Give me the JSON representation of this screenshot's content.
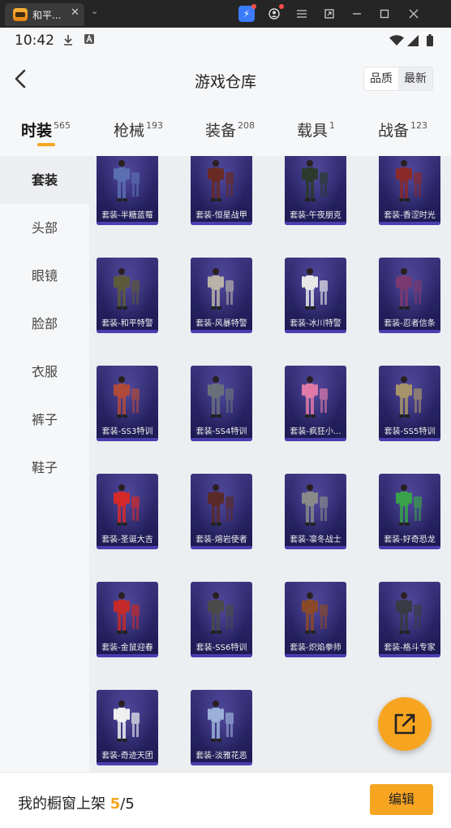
{
  "window": {
    "tab_title": "和平...",
    "close_glyph": "✕",
    "menu_glyph": "⌄",
    "toolbar_icons": [
      "lightning-icon",
      "user-icon",
      "hamburger-icon",
      "screenshot-icon",
      "minimize-icon",
      "maximize-icon",
      "close-icon"
    ]
  },
  "status_bar": {
    "time": "10:42"
  },
  "header": {
    "title": "游戏仓库",
    "sort_options": [
      "品质",
      "最新"
    ],
    "active_sort": "品质"
  },
  "category_tabs": [
    {
      "label": "时装",
      "count": "565"
    },
    {
      "label": "枪械",
      "count": "193"
    },
    {
      "label": "装备",
      "count": "208"
    },
    {
      "label": "载具",
      "count": "1"
    },
    {
      "label": "战备",
      "count": "123"
    }
  ],
  "sidebar": {
    "items": [
      "套装",
      "头部",
      "眼镜",
      "脸部",
      "衣服",
      "裤子",
      "鞋子"
    ],
    "active": "套装"
  },
  "items": [
    {
      "label": "套装-半糖蓝莓",
      "color": "#5a6fb0"
    },
    {
      "label": "套装-恒星战甲",
      "color": "#6a2a24"
    },
    {
      "label": "套装-午夜朋克",
      "color": "#2c3a2c"
    },
    {
      "label": "套装-香涩时光",
      "color": "#8a2a2a"
    },
    {
      "label": "套装-和平特警",
      "color": "#5c5a3a"
    },
    {
      "label": "套装-风暴特警",
      "color": "#b8b2a8"
    },
    {
      "label": "套装-冰川特警",
      "color": "#e8e8e8"
    },
    {
      "label": "套装-忍者信条",
      "color": "#7a3a70"
    },
    {
      "label": "套装-SS3特训",
      "color": "#b04a3a"
    },
    {
      "label": "套装-SS4特训",
      "color": "#6a707a"
    },
    {
      "label": "套装-疯狂小...",
      "color": "#e07aa8"
    },
    {
      "label": "套装-SS5特训",
      "color": "#a8946a"
    },
    {
      "label": "套装-圣诞大吉",
      "color": "#d42a2a"
    },
    {
      "label": "套装-熔岩使者",
      "color": "#5a2a28"
    },
    {
      "label": "套装-凛冬战士",
      "color": "#8a8a8a"
    },
    {
      "label": "套装-好奇恐龙",
      "color": "#3aa24a"
    },
    {
      "label": "套装-金鼠迎春",
      "color": "#c42a2a"
    },
    {
      "label": "套装-SS6特训",
      "color": "#4a4a4a"
    },
    {
      "label": "套装-炽焰拳师",
      "color": "#8a4a2a"
    },
    {
      "label": "套装-格斗专家",
      "color": "#3a3a44"
    },
    {
      "label": "套装-奇迹天团",
      "color": "#f0f0f0"
    },
    {
      "label": "套装-淡雅花恶",
      "color": "#9ab0d8"
    }
  ],
  "footer": {
    "label": "我的橱窗上架",
    "count": "5",
    "separator": "/",
    "total": "5",
    "edit_label": "编辑"
  },
  "colors": {
    "accent": "#f5a623",
    "card_bg": "#2a2466"
  }
}
